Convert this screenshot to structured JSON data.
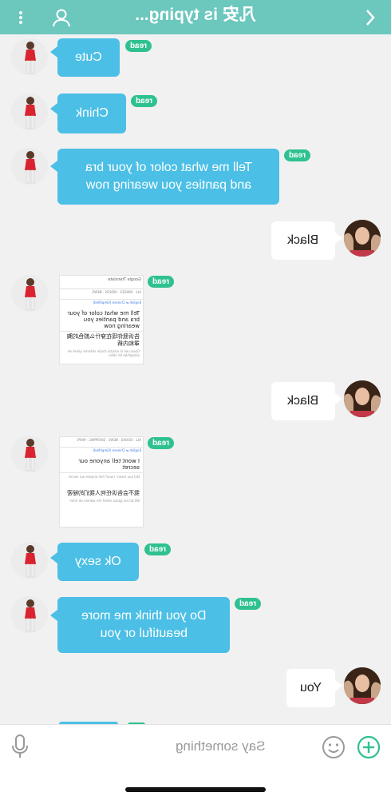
{
  "header": {
    "title": "凡安 is typing...",
    "back_icon": "chevron-right-icon",
    "menu_icon": "more-vertical-icon",
    "profile_icon": "user-icon",
    "bar_color": "#6cc7bd"
  },
  "messages": [
    {
      "sender": "other",
      "text": "Cute",
      "status": "read"
    },
    {
      "sender": "other",
      "text": "Chink",
      "status": "read"
    },
    {
      "sender": "other",
      "text": "Tell me what color of your bra\nand panties you wearing now",
      "status": "read"
    },
    {
      "sender": "me",
      "text": "Black"
    },
    {
      "sender": "other",
      "type": "image",
      "status": "read",
      "image": {
        "app_title": "Google Translate",
        "tabs": [
          "ALL",
          "IMAGES",
          "VIDEOS",
          "NEWS"
        ],
        "lang": "English ⇄ Chinese (Simplified)",
        "source": "Tell me what color of your bra and panties you wearing now",
        "target": "告诉我你现在穿什么颜色的胸罩和内裤",
        "note": "Gàosù wǒ nǐ xiànzài chuān shénme yánsè de xiōngzhào hé nèikù"
      }
    },
    {
      "sender": "me",
      "text": "Black"
    },
    {
      "sender": "other",
      "type": "image",
      "status": "read",
      "image": {
        "tabs": [
          "ALL",
          "BOOKS",
          "NEWS",
          "SHOPPING",
          "MAPS"
        ],
        "lang": "English ⇄ Chinese (Simplified)",
        "source": "I wont tell anyone our secret",
        "hint": "Did you mean: I won't tell anyone our secret",
        "target": "我不会告诉任何人我们的秘密",
        "note": "Wǒ bù huì gàosù rènhé rén wǒmen de mìmì"
      }
    },
    {
      "sender": "other",
      "text": "Ok sexy",
      "status": "read"
    },
    {
      "sender": "other",
      "text": "Do you think me more\nbeautiful or you",
      "status": "read"
    },
    {
      "sender": "me",
      "text": "You"
    }
  ],
  "input": {
    "placeholder": "Say something",
    "mic_icon": "microphone-icon",
    "emoji_icon": "smiley-icon",
    "add_icon": "plus-circle-icon"
  },
  "colors": {
    "accent": "#6cc7bd",
    "incoming_bubble": "#4bbfe6",
    "outgoing_bubble": "#ffffff",
    "read_badge": "#2fc191",
    "add_button": "#2fc191"
  }
}
